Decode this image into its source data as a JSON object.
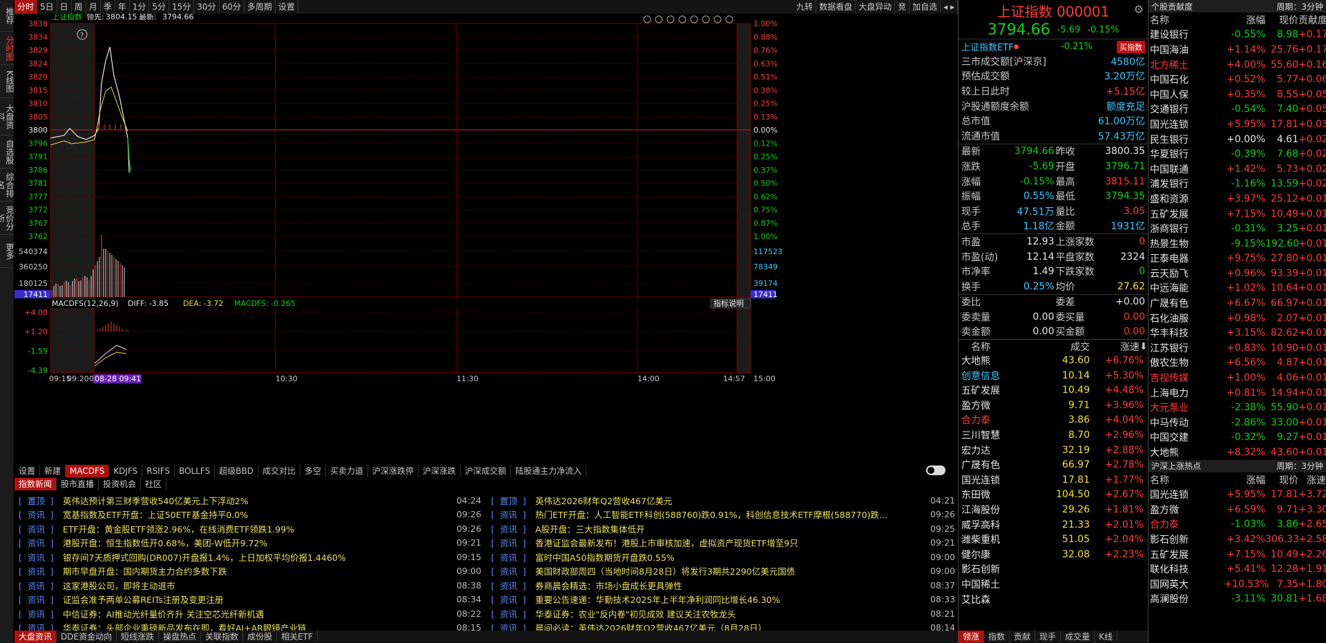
{
  "vertical_tabs": [
    "推荐",
    "分时图",
    "K线图",
    "大盘资料",
    "自选股",
    "综合排名",
    "竞价分析",
    "更多"
  ],
  "toolbar": {
    "periods": [
      "分时",
      "5日",
      "日",
      "周",
      "月",
      "季",
      "年",
      "1分",
      "5分",
      "15分",
      "30分",
      "60分",
      "多周期",
      "设置"
    ],
    "active": "分时",
    "right_buttons": [
      "九转",
      "数据看盘",
      "大盘异动",
      "竞",
      "加自选"
    ]
  },
  "chart_header": {
    "name": "上证指数",
    "lead_label": "领先:",
    "lead_value": "3804.15",
    "latest_label": "最新:",
    "latest_value": "3794.66"
  },
  "price_axis": [
    "3838",
    "3834",
    "3829",
    "3824",
    "3820",
    "3815",
    "3810",
    "3805",
    "3800",
    "3796",
    "3791",
    "3786",
    "3781",
    "3777",
    "3772",
    "3767",
    "3762"
  ],
  "pct_axis": [
    "1.00%",
    "0.88%",
    "0.76%",
    "0.63%",
    "0.51%",
    "0.38%",
    "0.25%",
    "0.13%",
    "0.00%",
    "0.12%",
    "0.25%",
    "0.37%",
    "0.50%",
    "0.62%",
    "0.75%",
    "0.87%",
    "1.00%"
  ],
  "volume_axis_left": [
    "540374",
    "360250",
    "180125"
  ],
  "volume_axis_right": [
    "117523",
    "78349",
    "39174"
  ],
  "volume_marker": "17411",
  "macd_header": {
    "label": "MACDFS(12,26,9)",
    "diff": "DIFF: -3.85",
    "dea": "DEA: -3.72",
    "macdfs": "MACDFS: -0.265",
    "help": "指标说明"
  },
  "macd_axis": [
    "+4.00",
    "+1.20",
    "-1.59",
    "-4.39"
  ],
  "time_axis": [
    "09:15",
    "09:20",
    "09:25",
    "08-28 09:41",
    "10:30",
    "11:30",
    "14:00",
    "14:57",
    "15:00"
  ],
  "indicator_tabs": [
    "设置",
    "新建",
    "MACDFS",
    "KDJFS",
    "RSIFS",
    "BOLLFS",
    "超级BBD",
    "成交对比",
    "多空",
    "买卖力道",
    "沪深涨跌停",
    "沪深涨跌",
    "沪深成交额",
    "陆股通主力净流入"
  ],
  "indicator_active": "MACDFS",
  "news_tabs": [
    "指数新闻",
    "股市直播",
    "投资机会",
    "社区"
  ],
  "news_left": [
    {
      "tag": "置顶",
      "title": "英伟达预计第三财季营收540亿美元上下浮动2%",
      "time": "04:24"
    },
    {
      "tag": "资讯",
      "title": "宽基指数及ETF开盘：上证50ETF基金持平0.0%",
      "time": "09:26"
    },
    {
      "tag": "资讯",
      "title": "ETF开盘：黄金股ETF领涨2.96%，在线消费ETF领跌1.99%",
      "time": "09:26"
    },
    {
      "tag": "资讯",
      "title": "港股开盘：恒生指数低开0.68%，美团-W低开9.72%",
      "time": "09:21"
    },
    {
      "tag": "资讯",
      "title": "银存间7天质押式回购(DR007)开盘报1.4%，上日加权平均价报1.4460%",
      "time": "09:15"
    },
    {
      "tag": "资讯",
      "title": "期市早盘开盘：国内期货主力合约多数下跌",
      "time": "09:00"
    },
    {
      "tag": "资讯",
      "title": "这家港股公司，即将主动退市",
      "time": "08:38"
    },
    {
      "tag": "资讯",
      "title": "证监会准予两单公募REITs注册及变更注册",
      "time": "08:34"
    },
    {
      "tag": "资讯",
      "title": "中信证券：AI推动光纤量价齐升 关注空芯光纤新机遇",
      "time": "08:22"
    },
    {
      "tag": "资讯",
      "title": "华泰证券：头部企业重磅新品发布在即，看好AI+AR眼镜产业链",
      "time": "08:15"
    }
  ],
  "news_right": [
    {
      "tag": "置顶",
      "title": "英伟达2026财年Q2营收467亿美元",
      "time": "04:21"
    },
    {
      "tag": "资讯",
      "title": "热门ETF开盘：人工智能ETF科创(588760)跌0.91%，科创信息技术ETF摩根(588770)跌...",
      "time": "09:26"
    },
    {
      "tag": "资讯",
      "title": "A股开盘：三大指数集体低开",
      "time": "09:25"
    },
    {
      "tag": "资讯",
      "title": "香港证监会最新发布！港股上市审核加速，虚拟资产现货ETF增至9只",
      "time": "09:21"
    },
    {
      "tag": "资讯",
      "title": "富时中国A50指数期货开盘跌0.55%",
      "time": "09:00"
    },
    {
      "tag": "资讯",
      "title": "美国财政部周四（当地时间8月28日）将发行3期共2290亿美元国债",
      "time": "09:00"
    },
    {
      "tag": "资讯",
      "title": "券商晨会精选：市场小盘成长更具弹性",
      "time": "08:37"
    },
    {
      "tag": "资讯",
      "title": "重要公告速递：华勤技术2025年上半年净利润同比增长46.30%",
      "time": "08:33"
    },
    {
      "tag": "资讯",
      "title": "华泰证券：农业\"反内卷\"初见成效 建议关注农牧龙头",
      "time": "08:21"
    },
    {
      "tag": "资讯",
      "title": "晨间必读：英伟达2026财年Q2营收467亿美元（8月28日）",
      "time": "08:14"
    }
  ],
  "bottom_bar": [
    "大盘资讯",
    "DDE资金动向",
    "短线涨跌",
    "操盘热点",
    "关联指数",
    "成份股",
    "相关ETF"
  ],
  "index_panel": {
    "title": "上证指数 000001",
    "price": "3794.66",
    "change": "-5.69",
    "change_pct": "-0.15%",
    "etf_label": "上证指数ETF",
    "etf_pct": "-0.21%",
    "etf_btn": "买指数",
    "stats": [
      {
        "label": "三市成交额[沪深京]",
        "value": "4580亿"
      },
      {
        "label": "预估成交额",
        "value": "3.20万亿"
      },
      {
        "label": "较上日此时",
        "value": "+5.15亿"
      },
      {
        "label": "沪股通额度余额",
        "value": "额度充足"
      },
      {
        "label": "总市值",
        "value": "61.00万亿"
      },
      {
        "label": "流通市值",
        "value": "57.43万亿"
      }
    ],
    "quote": [
      [
        "最新",
        "3794.66",
        "昨收",
        "3800.35"
      ],
      [
        "涨跌",
        "-5.69",
        "开盘",
        "3796.71"
      ],
      [
        "涨幅",
        "-0.15%",
        "最高",
        "3815.11"
      ],
      [
        "振幅",
        "0.55%",
        "最低",
        "3794.35"
      ],
      [
        "现手",
        "47.51万",
        "量比",
        "3.05"
      ],
      [
        "总手",
        "1.18亿",
        "金额",
        "1931亿"
      ]
    ],
    "quote2": [
      [
        "市盈",
        "12.93",
        "上涨家数",
        "0"
      ],
      [
        "市盈(动)",
        "12.14",
        "平盘家数",
        "2324"
      ],
      [
        "市净率",
        "1.49",
        "下跌家数",
        "0"
      ],
      [
        "换手",
        "0.25%",
        "均价",
        "27.62"
      ]
    ],
    "orders": [
      [
        "委比",
        "",
        "委差",
        "+0.00"
      ],
      [
        "委卖量",
        "0.00",
        "委买量",
        "0.00"
      ],
      [
        "卖金额",
        "0.00",
        "买金额",
        "0.00"
      ]
    ],
    "list_header": [
      "名称",
      "成交",
      "涨速"
    ],
    "list": [
      [
        "大地熊",
        "43.60",
        "+6.76%",
        "w"
      ],
      [
        "创意信息",
        "10.14",
        "+5.30%",
        "c"
      ],
      [
        "五矿发展",
        "10.49",
        "+4.48%",
        "w"
      ],
      [
        "盈方微",
        "9.71",
        "+3.96%",
        "w"
      ],
      [
        "合力泰",
        "3.86",
        "+4.04%",
        "o"
      ],
      [
        "三川智慧",
        "8.70",
        "+2.96%",
        "w"
      ],
      [
        "宏力达",
        "32.19",
        "+2.88%",
        "w"
      ],
      [
        "广晟有色",
        "66.97",
        "+2.78%",
        "w"
      ],
      [
        "国光连锁",
        "17.81",
        "+1.77%",
        "w"
      ],
      [
        "东田微",
        "104.50",
        "+2.67%",
        "w"
      ],
      [
        "江海股份",
        "29.26",
        "+1.81%",
        "w"
      ],
      [
        "威孚高科",
        "21.33",
        "+2.01%",
        "w"
      ],
      [
        "潍柴重机",
        "51.05",
        "+2.04%",
        "w"
      ],
      [
        "健尔康",
        "32.08",
        "+2.23%",
        "w"
      ],
      [
        "影石创新",
        "",
        ""
      ],
      [
        "中国稀土",
        "",
        ""
      ],
      [
        "艾比森",
        "",
        ""
      ]
    ],
    "bottom_tabs": [
      "领涨",
      "指数",
      "贡献",
      "现手",
      "成交量",
      "K线"
    ]
  },
  "contrib": {
    "title": "个股贡献度",
    "period": "周期：3分钟",
    "headers": [
      "名称",
      "涨幅",
      "现价",
      "贡献度"
    ],
    "rows": [
      [
        "建设银行",
        "-0.55%",
        "8.98",
        "+0.17",
        "w"
      ],
      [
        "中国海油",
        "+1.14%",
        "25.76",
        "+0.17",
        "w"
      ],
      [
        "北方稀土",
        "+4.00%",
        "55.60",
        "+0.16",
        "r"
      ],
      [
        "中国石化",
        "+0.52%",
        "5.77",
        "+0.06",
        "w"
      ],
      [
        "中国人保",
        "+0.35%",
        "8.55",
        "+0.05",
        "w"
      ],
      [
        "交通银行",
        "-0.54%",
        "7.40",
        "+0.05",
        "w"
      ],
      [
        "国光连锁",
        "+5.95%",
        "17.81",
        "+0.03",
        "w"
      ],
      [
        "民生银行",
        "+0.00%",
        "4.61",
        "+0.02",
        "w"
      ],
      [
        "华夏银行",
        "-0.39%",
        "7.68",
        "+0.02",
        "w"
      ],
      [
        "中国联通",
        "+1.42%",
        "5.73",
        "+0.02",
        "w"
      ],
      [
        "浦发银行",
        "-1.16%",
        "13.59",
        "+0.02",
        "w"
      ],
      [
        "盛和资源",
        "+3.97%",
        "25.12",
        "+0.01",
        "w"
      ],
      [
        "五矿发展",
        "+7.15%",
        "10.49",
        "+0.01",
        "w"
      ],
      [
        "浙商银行",
        "-0.31%",
        "3.25",
        "+0.01",
        "w"
      ],
      [
        "热景生物",
        "-9.15%",
        "192.60",
        "+0.01",
        "w"
      ],
      [
        "正泰电器",
        "+9.75%",
        "27.80",
        "+0.01",
        "w"
      ],
      [
        "云天励飞",
        "+0.96%",
        "93.39",
        "+0.01",
        "w"
      ],
      [
        "中远海能",
        "+1.02%",
        "10.64",
        "+0.01",
        "w"
      ],
      [
        "广晟有色",
        "+6.67%",
        "66.97",
        "+0.01",
        "w"
      ],
      [
        "石化油服",
        "+0.98%",
        "2.07",
        "+0.01",
        "w"
      ],
      [
        "华丰科技",
        "+3.15%",
        "82.62",
        "+0.01",
        "w"
      ],
      [
        "江苏银行",
        "+0.83%",
        "10.90",
        "+0.01",
        "w"
      ],
      [
        "傲农生物",
        "+6.56%",
        "4.87",
        "+0.01",
        "w"
      ],
      [
        "吉视传媒",
        "+1.00%",
        "4.06",
        "+0.01",
        "r"
      ],
      [
        "上海电力",
        "+0.81%",
        "14.94",
        "+0.01",
        "w"
      ],
      [
        "大元泵业",
        "-2.38%",
        "55.90",
        "+0.01",
        "r"
      ],
      [
        "中马传动",
        "-2.86%",
        "33.00",
        "+0.01",
        "w"
      ],
      [
        "中国交建",
        "-0.32%",
        "9.27",
        "+0.01",
        "w"
      ],
      [
        "大地熊",
        "+8.32%",
        "43.60",
        "+0.01",
        "w"
      ]
    ],
    "hot_title": "沪深上涨热点",
    "hot_period": "周期：3分钟",
    "hot_headers": [
      "名称",
      "涨幅",
      "现价",
      "涨速"
    ],
    "hot_rows": [
      [
        "国光连锁",
        "+5.95%",
        "17.81",
        "+3.72%",
        "w"
      ],
      [
        "盈方微",
        "+6.59%",
        "9.71",
        "+3.30%",
        "w"
      ],
      [
        "合力泰",
        "-1.03%",
        "3.86",
        "+2.65%",
        "r"
      ],
      [
        "影石创新",
        "+3.42%",
        "306.33",
        "+2.58%",
        "w"
      ],
      [
        "五矿发展",
        "+7.15%",
        "10.49",
        "+2.26%",
        "w"
      ],
      [
        "联化科技",
        "+5.41%",
        "12.28",
        "+1.91%",
        "w"
      ],
      [
        "国网英大",
        "+10.53%",
        "7.35",
        "+1.80%",
        "w"
      ],
      [
        "高澜股份",
        "-3.11%",
        "30.81",
        "+1.68%",
        "w"
      ]
    ]
  }
}
